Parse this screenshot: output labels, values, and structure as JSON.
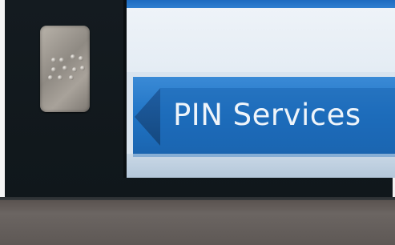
{
  "screen": {
    "button": {
      "label": "PIN Services",
      "icon": "chevron-left-icon",
      "color": "#1f73c4"
    }
  },
  "kiosk": {
    "braille_plate_icon": "braille-icon"
  }
}
